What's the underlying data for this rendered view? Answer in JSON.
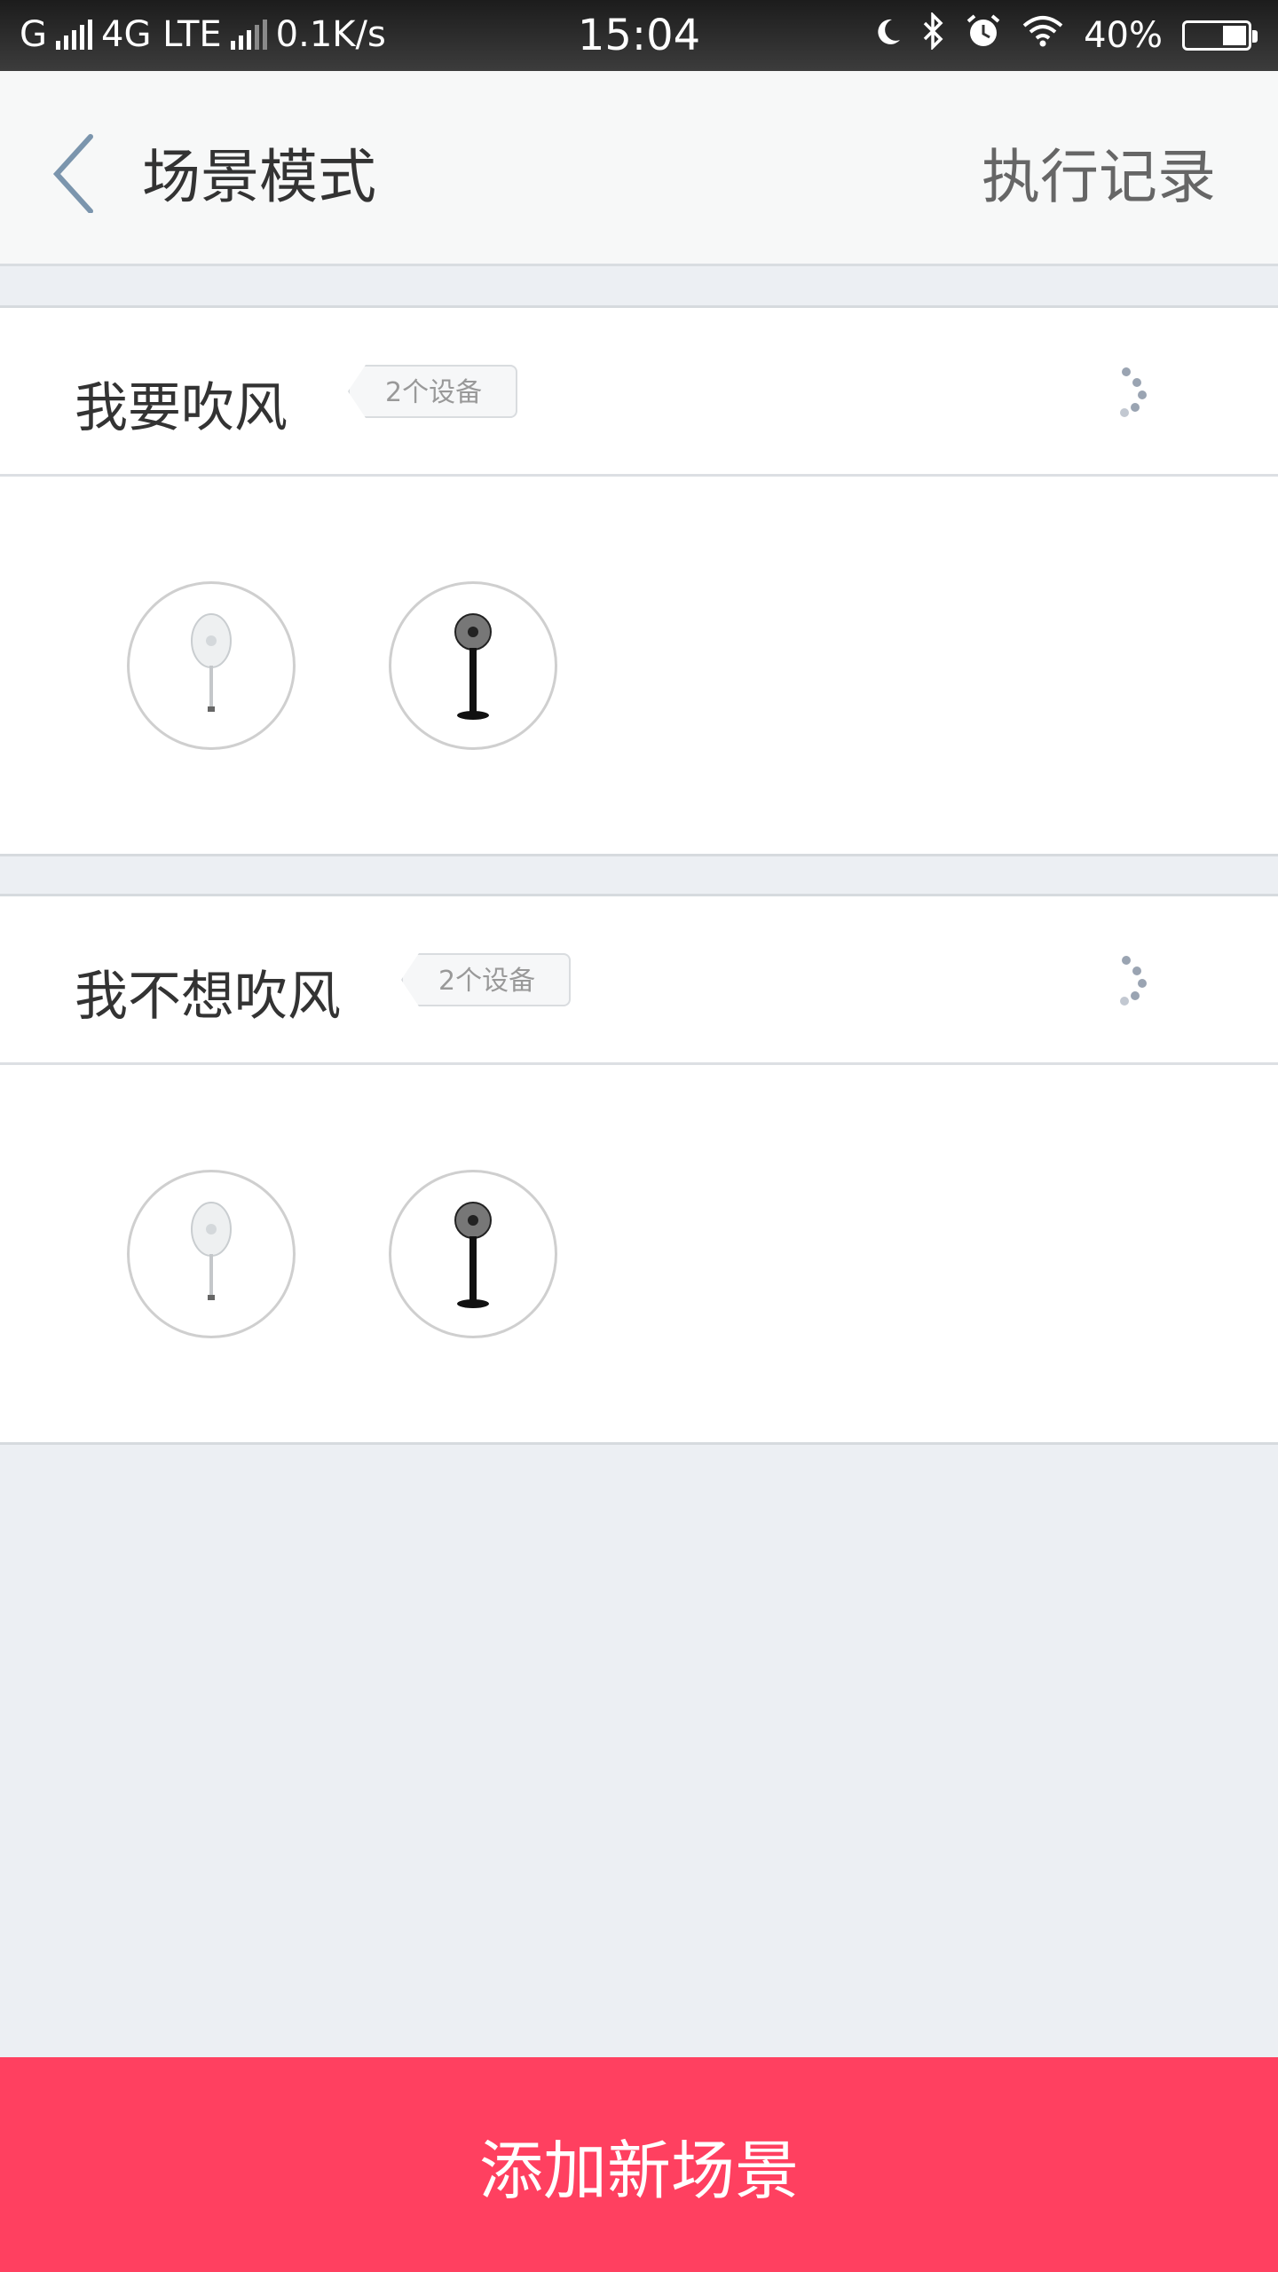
{
  "status_bar": {
    "carrier": "G",
    "network": "4G LTE",
    "speed": "0.1K/s",
    "time": "15:04",
    "battery": "40%",
    "battery_level": 0.4,
    "icons": [
      "moon-icon",
      "bluetooth-icon",
      "alarm-icon",
      "wifi-icon",
      "battery-icon"
    ]
  },
  "header": {
    "title": "场景模式",
    "history_label": "执行记录",
    "back_icon": "chevron-left-icon"
  },
  "scenes": [
    {
      "name": "我要吹风",
      "device_count_label": "2个设备",
      "devices": [
        {
          "icon": "white-stand-fan-icon"
        },
        {
          "icon": "black-stand-fan-icon"
        }
      ]
    },
    {
      "name": "我不想吹风",
      "device_count_label": "2个设备",
      "devices": [
        {
          "icon": "white-stand-fan-icon"
        },
        {
          "icon": "black-stand-fan-icon"
        }
      ]
    }
  ],
  "add_button_label": "添加新场景",
  "colors": {
    "accent": "#ff4060",
    "back_icon": "#7b95ad",
    "page_background": "#eceff3"
  }
}
